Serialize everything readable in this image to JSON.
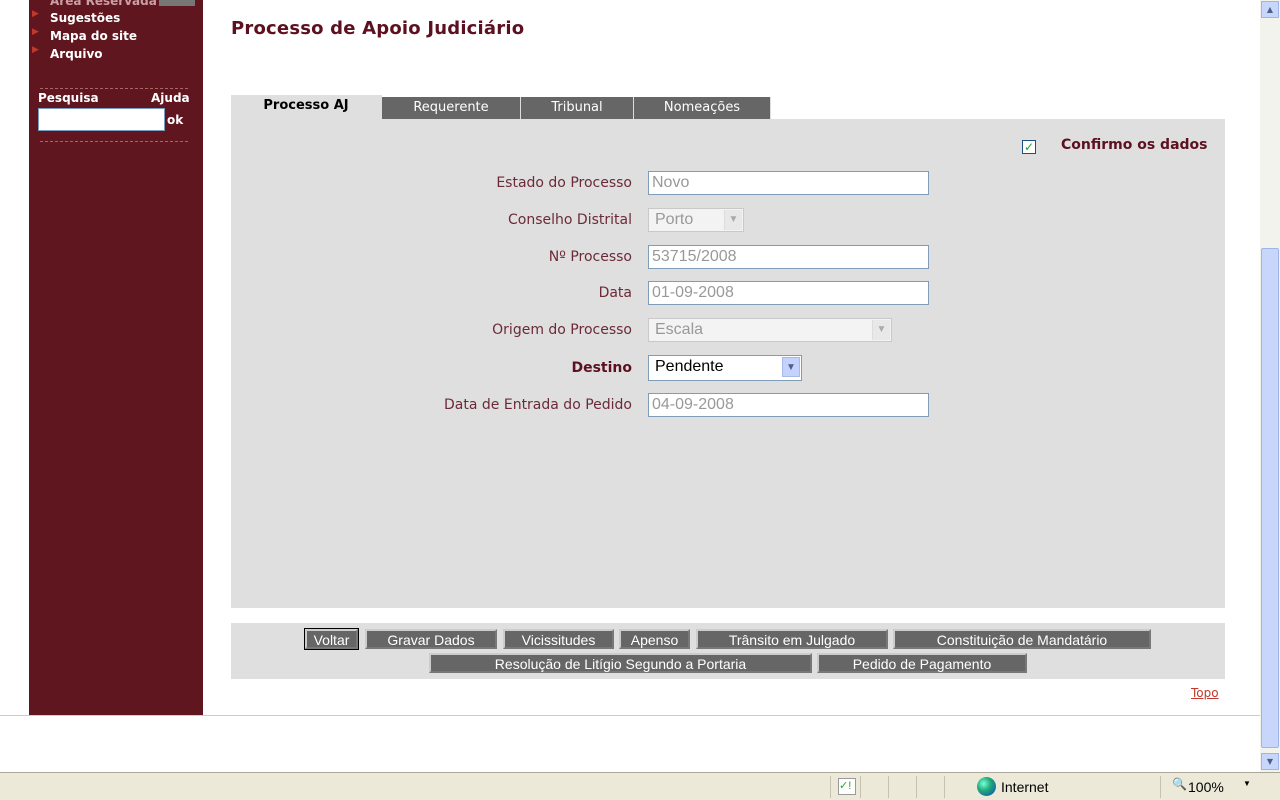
{
  "sidebar": {
    "items": [
      {
        "label": "Área Reservada"
      },
      {
        "label": "Sugestões"
      },
      {
        "label": "Mapa do site"
      },
      {
        "label": "Arquivo"
      }
    ],
    "search_label": "Pesquisa",
    "help_label": "Ajuda",
    "search_value": "",
    "ok_label": "ok"
  },
  "page_title": "Processo de Apoio Judiciário",
  "tabs": [
    {
      "label": "Processo AJ",
      "active": true
    },
    {
      "label": "Requerente"
    },
    {
      "label": "Tribunal"
    },
    {
      "label": "Nomeações"
    }
  ],
  "form": {
    "confirm_label": "Confirmo os dados",
    "confirm_checked": true,
    "fields": [
      {
        "label": "Estado do Processo",
        "value": "Novo"
      },
      {
        "label": "Conselho Distrital",
        "value": "Porto"
      },
      {
        "label": "Nº Processo",
        "value": "53715/2008"
      },
      {
        "label": "Data",
        "value": "01-09-2008"
      },
      {
        "label": "Origem do Processo",
        "value": "Escala"
      },
      {
        "label": "Destino",
        "value": "Pendente"
      },
      {
        "label": "Data de Entrada do Pedido",
        "value": "04-09-2008"
      }
    ]
  },
  "buttons": [
    "Voltar",
    "Gravar Dados",
    "Vicissitudes",
    "Apenso",
    "Trânsito em Julgado",
    "Constituição de Mandatário",
    "Resolução de Litígio Segundo a Portaria",
    "Pedido de Pagamento"
  ],
  "top_link": "Topo",
  "status": {
    "zone": "Internet",
    "zoom": "100%"
  }
}
